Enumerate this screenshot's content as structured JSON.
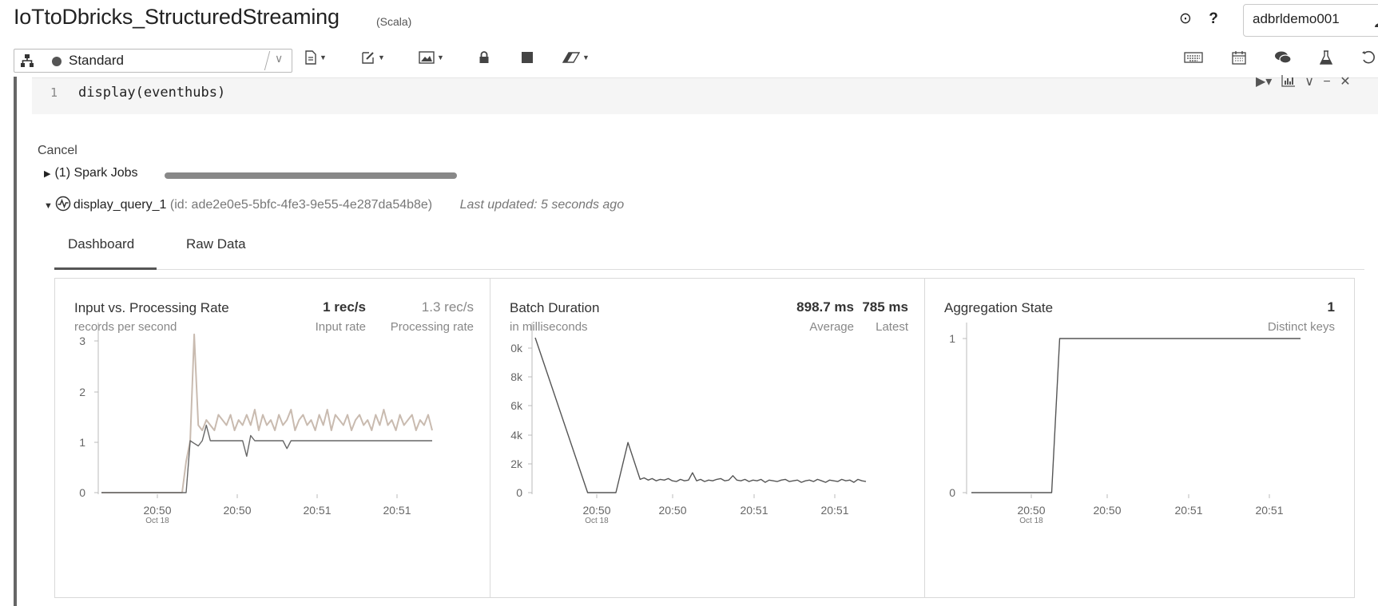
{
  "notebook": {
    "title": "IoTtoDbricks_StructuredStreaming",
    "language": "(Scala)"
  },
  "header": {
    "user": "adbrldemo001"
  },
  "toolbar": {
    "cluster_name": "Standard"
  },
  "cell": {
    "line_number": "1",
    "code": "display(eventhubs)"
  },
  "output": {
    "cancel_label": "Cancel",
    "spark_jobs_label": "(1) Spark Jobs",
    "query_name": "display_query_1",
    "query_id": "(id: ade2e0e5-5bfc-4fe3-9e55-4e287da54b8e)",
    "last_updated": "Last updated: 5 seconds ago",
    "tabs": [
      {
        "label": "Dashboard",
        "active": true
      },
      {
        "label": "Raw Data",
        "active": false
      }
    ]
  },
  "panels": {
    "rate": {
      "title": "Input vs. Processing Rate",
      "subtitle": "records per second",
      "metric1_value": "1 rec/s",
      "metric1_label": "Input rate",
      "metric2_value": "1.3 rec/s",
      "metric2_label": "Processing rate"
    },
    "duration": {
      "title": "Batch Duration",
      "subtitle": "in milliseconds",
      "metric1_value": "898.7 ms",
      "metric1_label": "Average",
      "metric2_value": "785 ms",
      "metric2_label": "Latest"
    },
    "state": {
      "title": "Aggregation State",
      "metric1_value": "1",
      "metric1_label": "Distinct keys"
    }
  },
  "chart_data": [
    {
      "type": "line",
      "y_ticks": [
        "0",
        "1",
        "2",
        "3"
      ],
      "x_ticks": [
        "20:50",
        "20:50",
        "20:51",
        "20:51"
      ],
      "x_subtick": "Oct 18",
      "ylim": [
        0,
        3.2
      ],
      "series": [
        {
          "color": "#c9bbb0",
          "x": [
            0,
            20,
            21,
            22,
            23,
            24,
            25,
            26,
            27,
            28,
            29,
            30,
            31,
            32,
            33,
            34,
            35,
            36,
            37,
            38,
            39,
            40,
            41,
            42,
            43,
            44,
            45,
            46,
            47,
            48,
            49,
            50,
            51,
            52,
            53,
            54,
            55,
            56,
            57,
            58,
            59,
            60,
            61,
            62,
            63,
            64,
            65,
            66,
            67,
            68,
            69,
            70,
            71,
            72,
            73,
            74,
            75,
            76,
            77,
            78,
            79,
            80,
            81,
            82
          ],
          "values": [
            0,
            0,
            0.6,
            1,
            3.05,
            1.3,
            1.2,
            1.4,
            1.3,
            1.2,
            1.5,
            1.4,
            1.3,
            1.5,
            1.2,
            1.4,
            1.3,
            1.5,
            1.3,
            1.6,
            1.2,
            1.5,
            1.3,
            1.4,
            1.2,
            1.5,
            1.3,
            1.4,
            1.6,
            1.2,
            1.4,
            1.5,
            1.3,
            1.4,
            1.2,
            1.5,
            1.3,
            1.6,
            1.2,
            1.5,
            1.4,
            1.3,
            1.5,
            1.2,
            1.4,
            1.5,
            1.3,
            1.4,
            1.2,
            1.5,
            1.3,
            1.6,
            1.3,
            1.4,
            1.2,
            1.5,
            1.3,
            1.4,
            1.5,
            1.2,
            1.4,
            1.3,
            1.5,
            1.2
          ]
        },
        {
          "color": "#666666",
          "x": [
            0,
            21,
            22,
            23,
            24,
            25,
            26,
            27,
            28,
            30,
            35,
            36,
            37,
            38,
            40,
            45,
            46,
            47,
            48,
            50,
            60,
            70,
            82
          ],
          "values": [
            0,
            0,
            1,
            0.95,
            0.9,
            1,
            1.3,
            1,
            1,
            1,
            1,
            0.7,
            1.1,
            1,
            1,
            1,
            0.85,
            1,
            1,
            1,
            1,
            1,
            1
          ]
        }
      ]
    },
    {
      "type": "line",
      "y_ticks": [
        "0",
        "2k",
        "4k",
        "6k",
        "8k",
        "0k"
      ],
      "x_ticks": [
        "20:50",
        "20:50",
        "20:51",
        "20:51"
      ],
      "x_subtick": "Oct 18",
      "series": [
        {
          "color": "#555555",
          "x": [
            0,
            13,
            20,
            23,
            26,
            27,
            28,
            29,
            30,
            31,
            32,
            33,
            34,
            35,
            36,
            37,
            38,
            39,
            40,
            41,
            42,
            43,
            44,
            45,
            46,
            47,
            48,
            49,
            50,
            51,
            52,
            53,
            54,
            55,
            56,
            57,
            58,
            59,
            60,
            61,
            62,
            63,
            64,
            65,
            66,
            67,
            68,
            69,
            70,
            71,
            72,
            73,
            74,
            75,
            76,
            77,
            78,
            79,
            80,
            81,
            82
          ],
          "values": [
            10500,
            0,
            0,
            3400,
            900,
            1000,
            850,
            950,
            800,
            900,
            850,
            950,
            800,
            750,
            900,
            800,
            850,
            1350,
            800,
            900,
            750,
            850,
            800,
            900,
            950,
            800,
            850,
            1150,
            850,
            800,
            900,
            750,
            850,
            800,
            900,
            700,
            850,
            800,
            750,
            850,
            900,
            750,
            800,
            850,
            700,
            800,
            850,
            750,
            900,
            800,
            700,
            850,
            800,
            750,
            900,
            800,
            850,
            700,
            900,
            800,
            750
          ]
        }
      ]
    },
    {
      "type": "line",
      "y_ticks": [
        "0",
        "1"
      ],
      "x_ticks": [
        "20:50",
        "20:50",
        "20:51",
        "20:51"
      ],
      "x_subtick": "Oct 18",
      "ylim": [
        0,
        1
      ],
      "series": [
        {
          "color": "#555555",
          "x": [
            0,
            20,
            22,
            82
          ],
          "values": [
            0,
            0,
            1,
            1
          ]
        }
      ]
    }
  ]
}
